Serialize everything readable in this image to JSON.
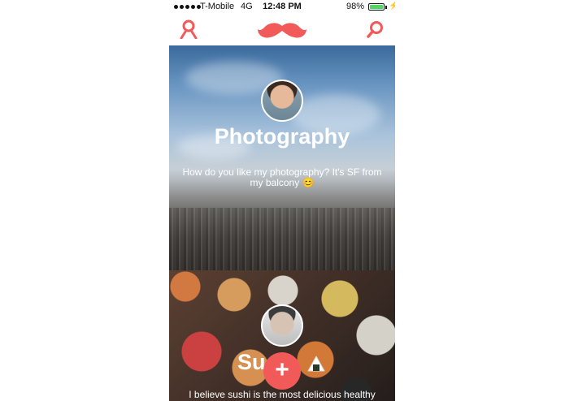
{
  "status_bar": {
    "carrier": "T-Mobile",
    "network": "4G",
    "time": "12:48 PM",
    "battery": "98%",
    "battery_level": 0.98
  },
  "nav": {
    "left_icon": "profile-icon",
    "logo": "mustache-logo",
    "right_icon": "search-icon",
    "accent_color": "#f25a5a"
  },
  "posts": [
    {
      "title": "Photography",
      "description": "How do you like my photography? It's SF from my balcony 😊"
    },
    {
      "title": "Su",
      "description": "I believe sushi is the most delicious healthy good out there! I can live on"
    }
  ],
  "fab": {
    "label": "+"
  }
}
